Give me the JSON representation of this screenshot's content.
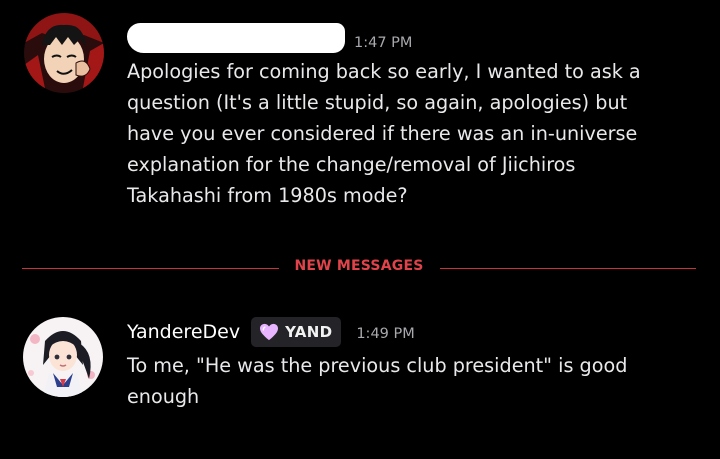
{
  "messages": [
    {
      "author": "",
      "author_redacted": true,
      "timestamp": "1:47 PM",
      "text": "Apologies for coming  back so early, I wanted to ask a\nquestion (It's a little stupid, so again, apologies) but\nhave you ever considered if there was an in-universe\nexplanation for the change/removal of Jiichiros\nTakahashi from 1980s mode?"
    },
    {
      "author": "YandereDev",
      "tag": "YAND",
      "tag_icon": "heart-icon",
      "timestamp": "1:49 PM",
      "text": "To me, \"He was the previous club president\" is good\nenough"
    }
  ],
  "divider": {
    "label": "NEW MESSAGES"
  },
  "colors": {
    "background": "#000000",
    "divider": "#c8333a",
    "divider_label": "#e0444a",
    "timestamp": "#a8a8ae",
    "tag_background": "#242428",
    "heart": "#e8b4ff"
  }
}
